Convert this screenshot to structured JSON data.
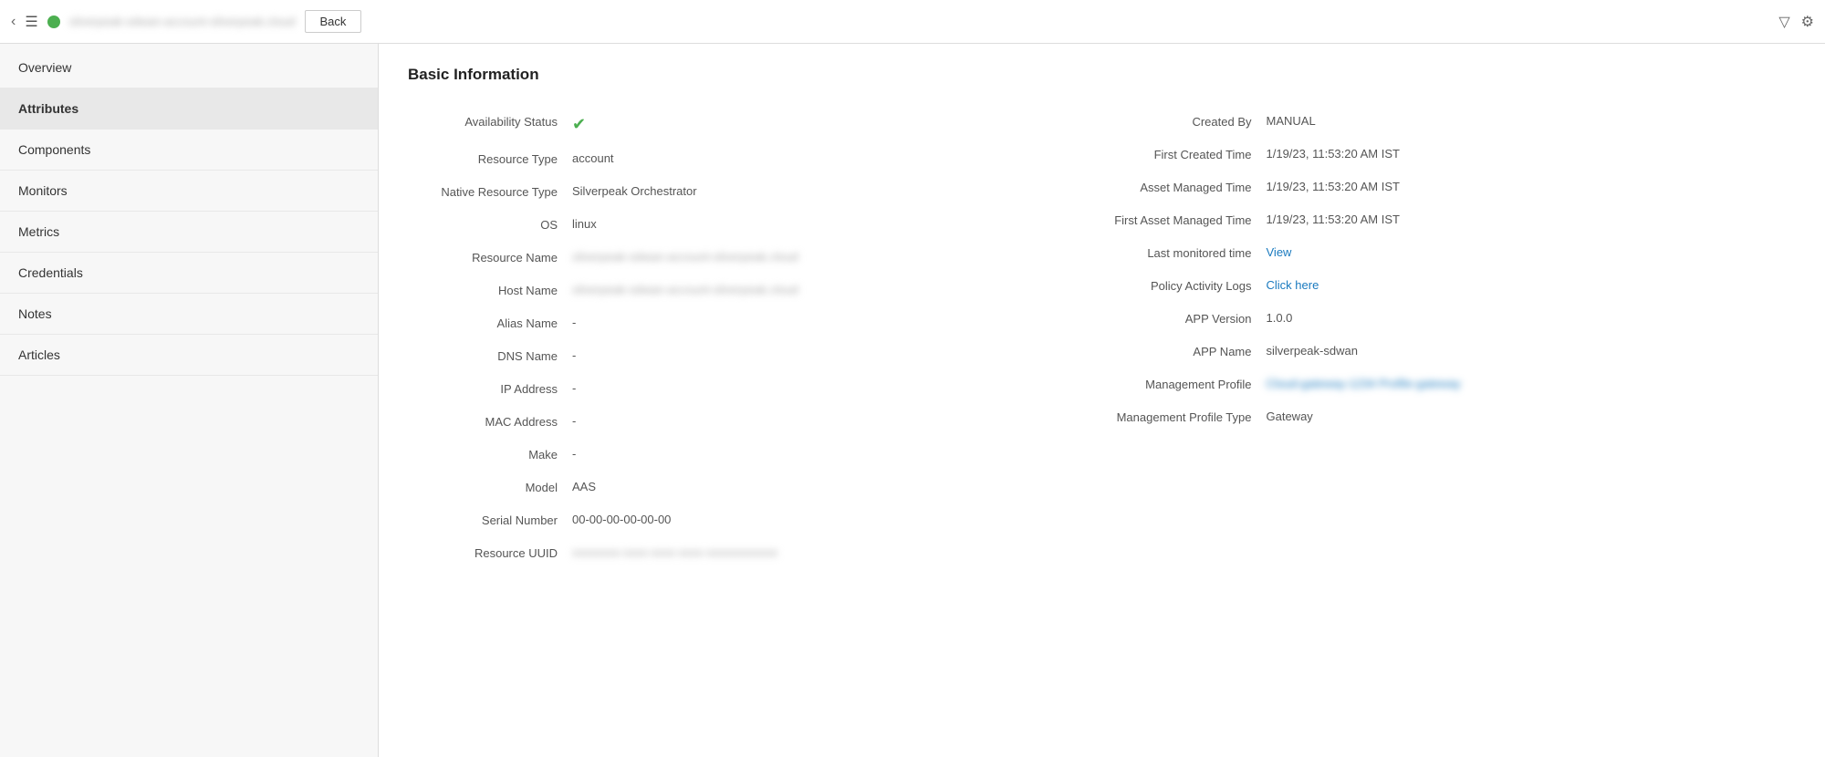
{
  "topBar": {
    "breadcrumb": "silverpeak-sdwan-account-silverpeak.cloud",
    "backButton": "Back",
    "hamburgerLabel": "menu"
  },
  "sidebar": {
    "items": [
      {
        "id": "overview",
        "label": "Overview",
        "active": false
      },
      {
        "id": "attributes",
        "label": "Attributes",
        "active": true
      },
      {
        "id": "components",
        "label": "Components",
        "active": false
      },
      {
        "id": "monitors",
        "label": "Monitors",
        "active": false
      },
      {
        "id": "metrics",
        "label": "Metrics",
        "active": false
      },
      {
        "id": "credentials",
        "label": "Credentials",
        "active": false
      },
      {
        "id": "notes",
        "label": "Notes",
        "active": false
      },
      {
        "id": "articles",
        "label": "Articles",
        "active": false
      }
    ]
  },
  "content": {
    "sectionTitle": "Basic Information",
    "leftColumn": [
      {
        "label": "Availability Status",
        "value": "●",
        "type": "icon"
      },
      {
        "label": "Resource Type",
        "value": "account",
        "type": "text"
      },
      {
        "label": "Native Resource Type",
        "value": "Silverpeak Orchestrator",
        "type": "text"
      },
      {
        "label": "OS",
        "value": "linux",
        "type": "text"
      },
      {
        "label": "Resource Name",
        "value": "silverpeak-sdwan-account-silverpeak.cloud",
        "type": "blurred"
      },
      {
        "label": "Host Name",
        "value": "silverpeak-sdwan-account-silverpeak.cloud",
        "type": "blurred"
      },
      {
        "label": "Alias Name",
        "value": "-",
        "type": "text"
      },
      {
        "label": "DNS Name",
        "value": "-",
        "type": "text"
      },
      {
        "label": "IP Address",
        "value": "-",
        "type": "text"
      },
      {
        "label": "MAC Address",
        "value": "-",
        "type": "text"
      },
      {
        "label": "Make",
        "value": "-",
        "type": "text"
      },
      {
        "label": "Model",
        "value": "AAS",
        "type": "text"
      },
      {
        "label": "Serial Number",
        "value": "00-00-00-00-00-00",
        "type": "text"
      },
      {
        "label": "Resource UUID",
        "value": "xxxxxxxx-xxxx-xxxx-xxxx-xxxxxxxxxxxx",
        "type": "blurred"
      }
    ],
    "rightColumn": [
      {
        "label": "Created By",
        "value": "MANUAL",
        "type": "text"
      },
      {
        "label": "First Created Time",
        "value": "1/19/23, 11:53:20 AM IST",
        "type": "text"
      },
      {
        "label": "Asset Managed Time",
        "value": "1/19/23, 11:53:20 AM IST",
        "type": "text"
      },
      {
        "label": "First Asset Managed Time",
        "value": "1/19/23, 11:53:20 AM IST",
        "type": "text"
      },
      {
        "label": "Last monitored time",
        "value": "View",
        "type": "link"
      },
      {
        "label": "Policy Activity Logs",
        "value": "Click here",
        "type": "link"
      },
      {
        "label": "APP Version",
        "value": "1.0.0",
        "type": "text"
      },
      {
        "label": "APP Name",
        "value": "silverpeak-sdwan",
        "type": "text"
      },
      {
        "label": "Management Profile",
        "value": "Cloud-gateway-1234 Profile-gateway",
        "type": "management-link"
      },
      {
        "label": "Management Profile Type",
        "value": "Gateway",
        "type": "text"
      }
    ]
  }
}
